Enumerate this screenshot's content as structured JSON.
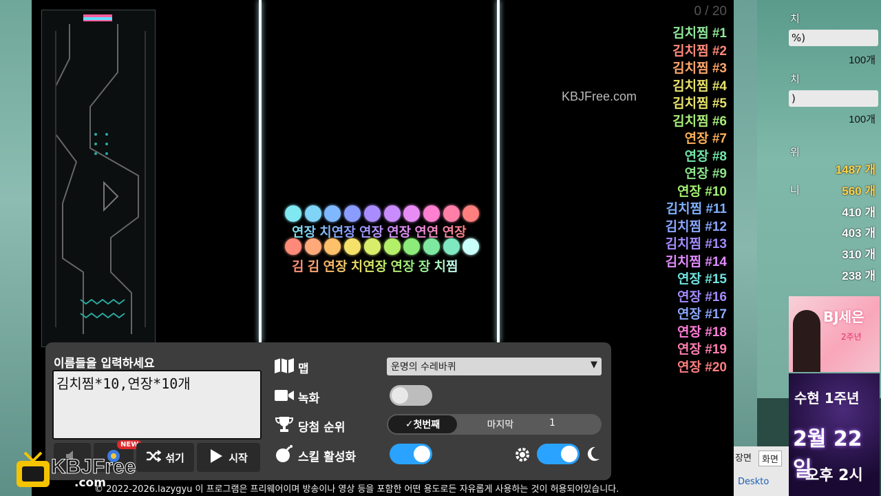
{
  "game": {
    "counter": "0 / 20",
    "watermark": "KBJFree.com",
    "ranks": [
      {
        "label": "김치찜 #1",
        "color": "#8fe89a"
      },
      {
        "label": "김치찜 #2",
        "color": "#ff8a7a"
      },
      {
        "label": "김치찜 #3",
        "color": "#ffa86b"
      },
      {
        "label": "김치찜 #4",
        "color": "#e8e26a"
      },
      {
        "label": "김치찜 #5",
        "color": "#e9e46b"
      },
      {
        "label": "김치찜 #6",
        "color": "#a8ec7a"
      },
      {
        "label": "연장 #7",
        "color": "#ffb05a"
      },
      {
        "label": "연장 #8",
        "color": "#72e8a8"
      },
      {
        "label": "연장 #9",
        "color": "#8de58a"
      },
      {
        "label": "연장 #10",
        "color": "#a3ef72"
      },
      {
        "label": "김치찜 #11",
        "color": "#7fb0ff"
      },
      {
        "label": "김치찜 #12",
        "color": "#8aa6ff"
      },
      {
        "label": "김치찜 #13",
        "color": "#a48cff"
      },
      {
        "label": "김치찜 #14",
        "color": "#e18cff"
      },
      {
        "label": "연장 #15",
        "color": "#6fe4e0"
      },
      {
        "label": "연장 #16",
        "color": "#a68cff"
      },
      {
        "label": "연장 #17",
        "color": "#8ca8ff"
      },
      {
        "label": "연장 #18",
        "color": "#ff7ed8"
      },
      {
        "label": "연장 #19",
        "color": "#ff7fb0"
      },
      {
        "label": "연장 #20",
        "color": "#ff7f7f"
      }
    ],
    "balls_top": [
      "#7fe8f0",
      "#7fd4f8",
      "#7fb8ff",
      "#8a9cff",
      "#a98cff",
      "#c98cff",
      "#e88cf5",
      "#ff7fd0",
      "#ff7fa8",
      "#ff7f7f"
    ],
    "balls_bottom": [
      "#ff8a7a",
      "#ffa87a",
      "#ffc06a",
      "#f5e06a",
      "#d8ee6a",
      "#b4ef6a",
      "#8cec7a",
      "#7fe8a0",
      "#7fe8c0",
      "#c8fff8"
    ],
    "ball_labels_top": "연장 치연장 연장 연장 연연 연장",
    "ball_labels_bottom": "김 김 연장 치연장 연장 장 치찜"
  },
  "panel": {
    "title": "이름들을 입력하세요",
    "names_value": "김치찜*10,연장*10개",
    "map_label": "맵",
    "map_selected": "운명의 수레바퀴",
    "record_label": "녹화",
    "rank_label": "당첨 순위",
    "rank_first": "첫번째",
    "rank_last": "마지막",
    "rank_number": "1",
    "skill_label": "스킬 활성화",
    "new_badge": "NEW",
    "shuffle_label": "섞기",
    "start_label": "시작",
    "accent": "#29a3ff"
  },
  "footer": {
    "copyright": "© 2022-2026.lazygyu 이 프로그램은 프리웨어이며 방송이나 영상 등을 포함한 어떤 용도로든 자유롭게 사용하는 것이 허용되어있습니다."
  },
  "logo": {
    "text": "KBJFree",
    "sub": ".com"
  },
  "sidebar": {
    "frag1": "치",
    "bar1": "%)",
    "count1": "100개",
    "frag2": "치",
    "bar2": ")",
    "count2": "100개",
    "frag3": "위",
    "values": [
      {
        "frag": "",
        "val": "1487 개",
        "color": "#ffd24a"
      },
      {
        "frag": "니",
        "val": "560 개",
        "color": "#ffd24a"
      },
      {
        "frag": "",
        "val": "410 개",
        "color": "#ffffff"
      },
      {
        "frag": "",
        "val": "403 개",
        "color": "#ffffff"
      },
      {
        "frag": "",
        "val": "310 개",
        "color": "#ffffff"
      },
      {
        "frag": "",
        "val": "238 개",
        "color": "#ffffff"
      }
    ]
  },
  "promo": {
    "name": "BJ세은",
    "sub": "2주년",
    "event_title": "수현 1주년",
    "event_date": "2월 22일",
    "event_time": "오후 2시"
  },
  "taskbar": {
    "a": "장면",
    "b": "화면",
    "c": "Deskto"
  }
}
